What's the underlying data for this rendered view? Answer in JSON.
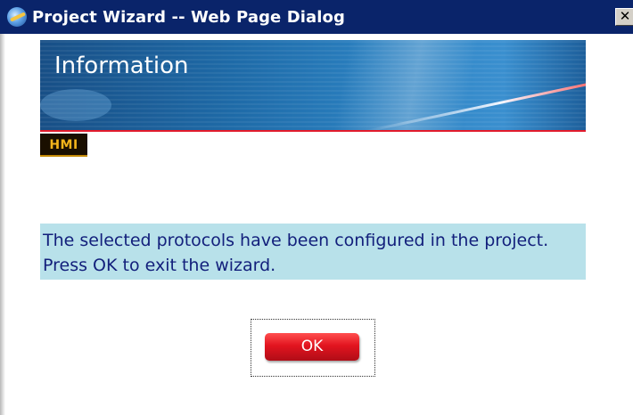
{
  "window": {
    "title": "Project Wizard -- Web Page Dialog",
    "title_icon": "ie-globe-icon",
    "close_symbol": "✕"
  },
  "banner": {
    "title": "Information",
    "accent_line_color": "#e21b2c"
  },
  "logo": {
    "text": "HMI"
  },
  "message": {
    "text": "The selected protocols have been configured in the project. Press OK to exit the wizard."
  },
  "ok_button": {
    "label": "OK",
    "color": "#e2141f"
  },
  "colors": {
    "titlebar": "#0a246a",
    "message_background": "#b8e1ea",
    "message_text": "#13207c"
  }
}
